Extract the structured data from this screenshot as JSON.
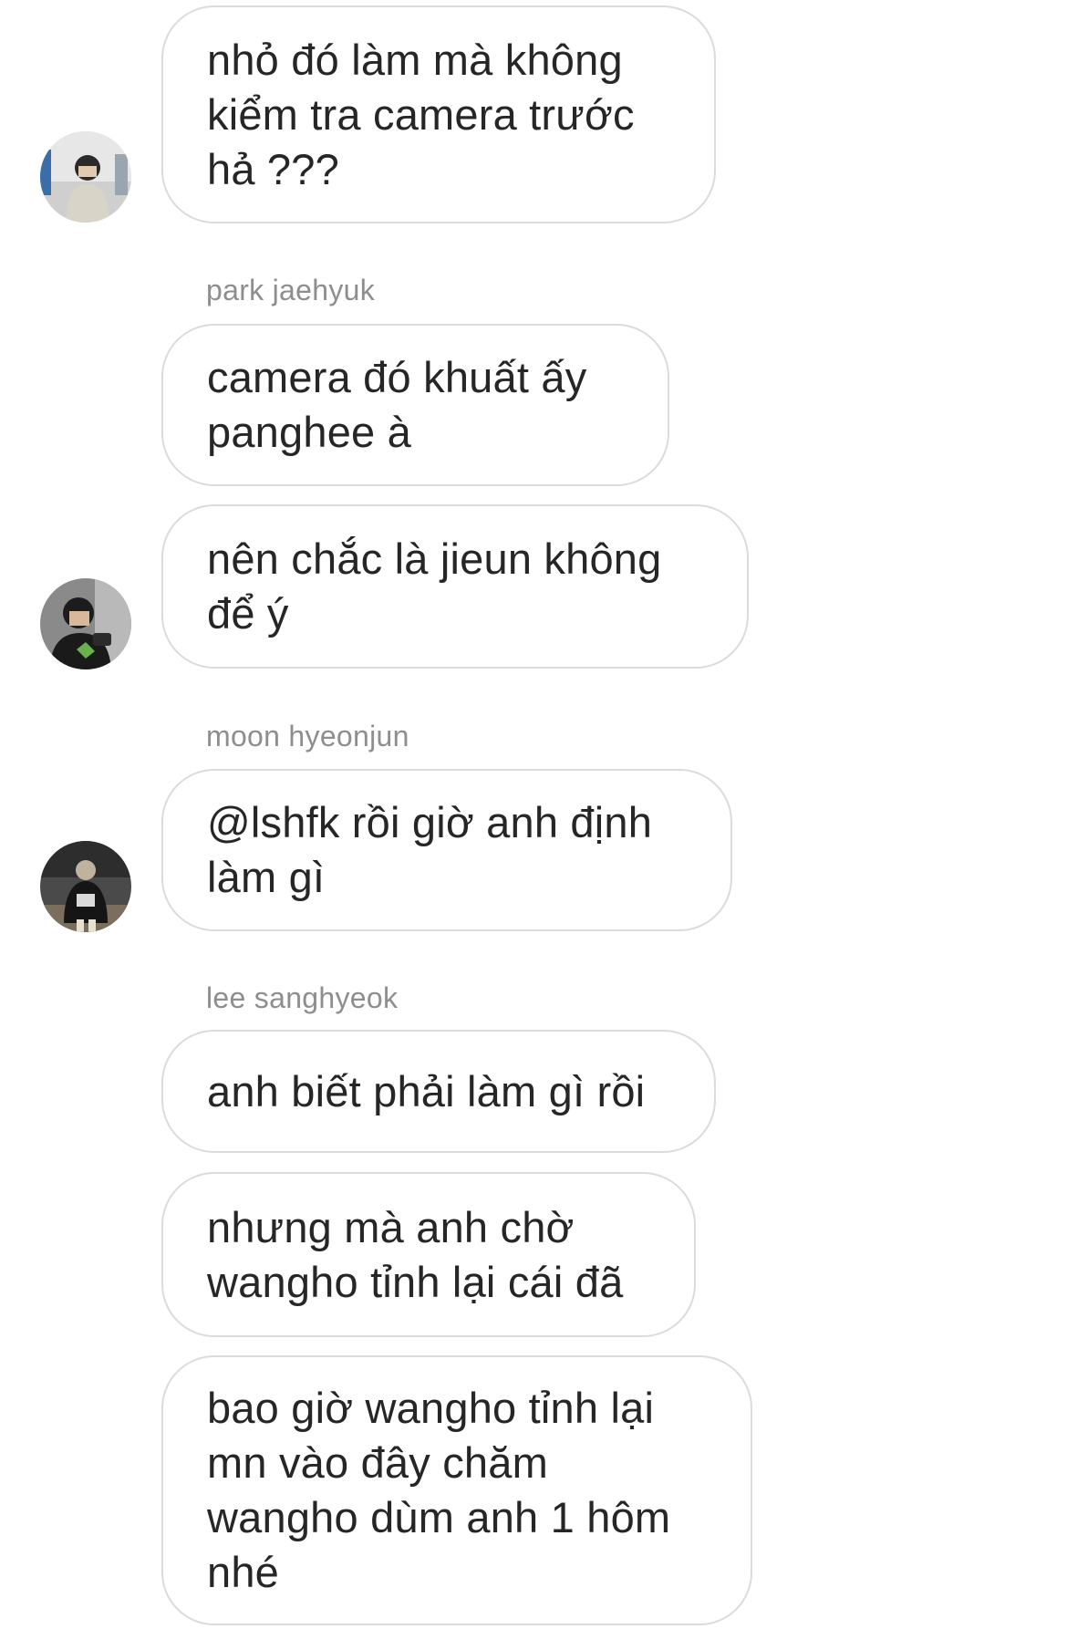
{
  "thread": {
    "messages": [
      {
        "text": "nhỏ đó làm mà không\nkiểm tra camera trước\nhả ???"
      },
      {
        "text": "camera đó khuất ấy\npanghee à"
      },
      {
        "text": "nên chắc là jieun không\nđể ý"
      },
      {
        "text": "@lshfk rồi giờ anh định\nlàm gì"
      },
      {
        "text": "anh biết phải làm gì rồi"
      },
      {
        "text": "nhưng mà anh chờ\nwangho tỉnh lại cái đã"
      },
      {
        "text": "bao giờ wangho tỉnh lại\nmn vào đây chăm\nwangho dùm anh 1 hôm\nnhé"
      }
    ],
    "senders": {
      "jaehyuk": "park jaehyuk",
      "hyeonjun": "moon hyeonjun",
      "sanghyeok": "lee sanghyeok"
    }
  },
  "colors": {
    "bubble_border": "#dbdbdb",
    "text": "#262626",
    "sender_label": "#8e8e8e",
    "background": "#ffffff"
  }
}
